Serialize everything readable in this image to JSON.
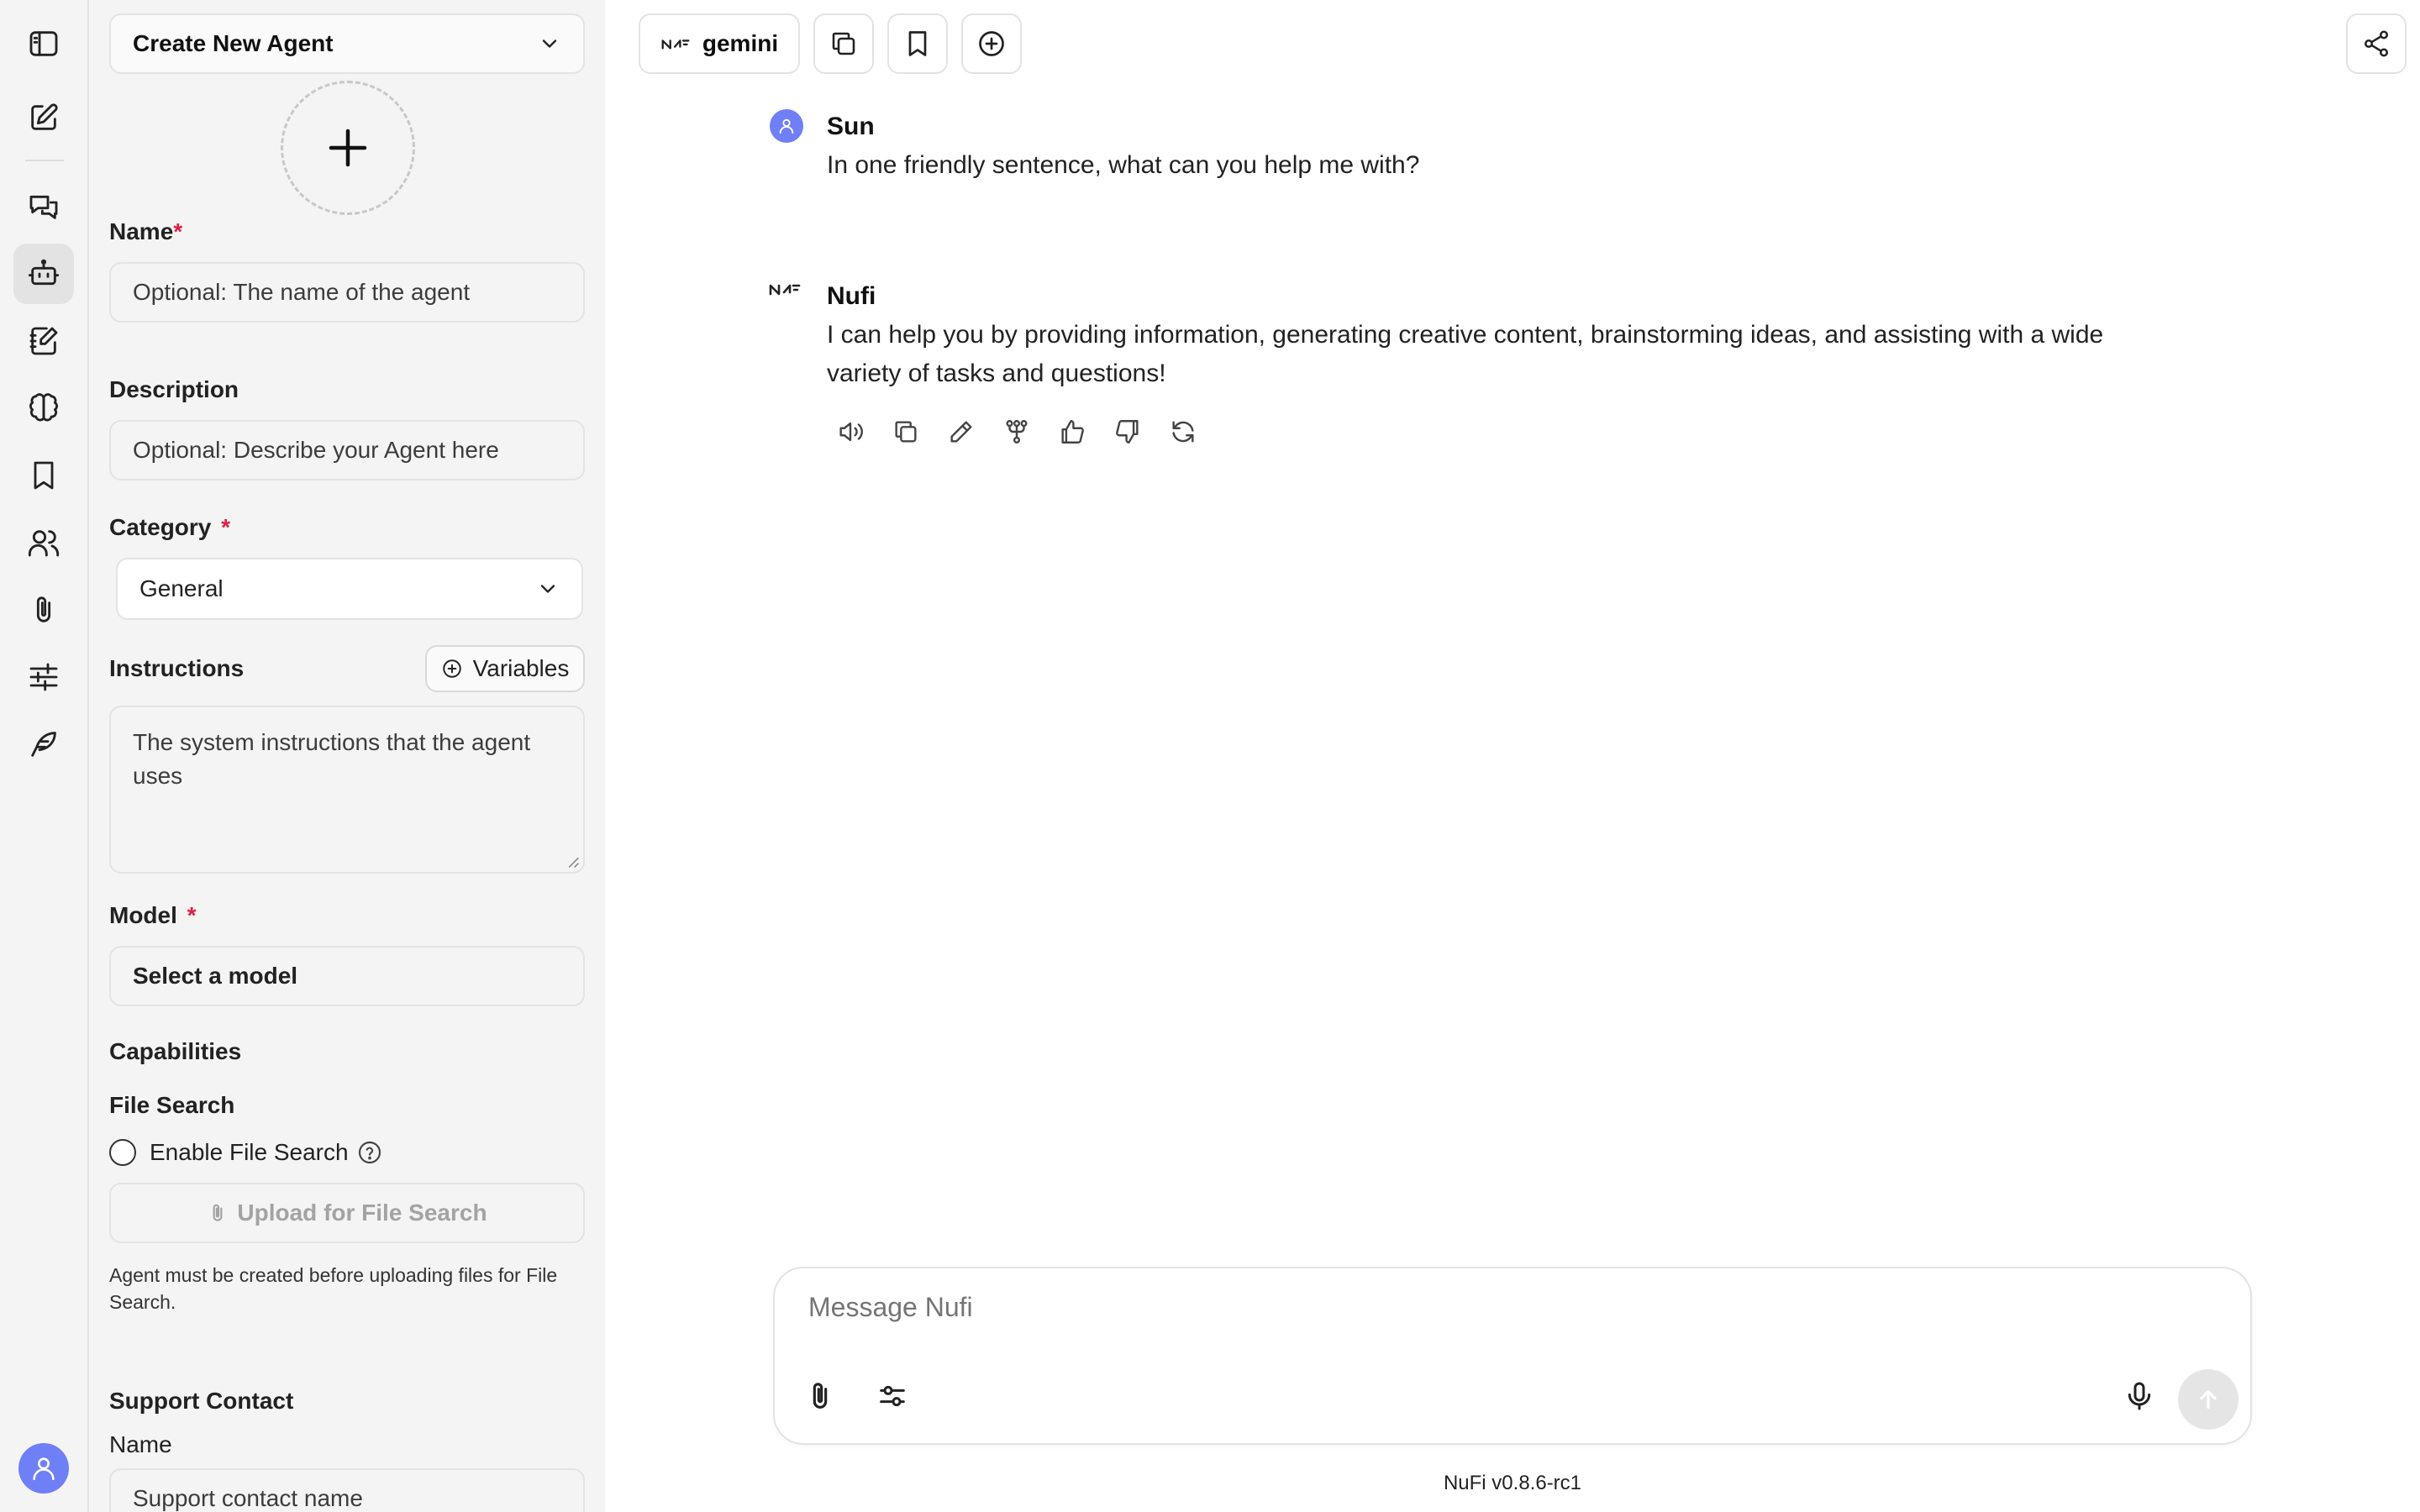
{
  "panel": {
    "agent_select": "Create New Agent",
    "name_label": "Name",
    "required_mark": "*",
    "name_placeholder": "Optional: The name of the agent",
    "description_label": "Description",
    "description_placeholder": "Optional: Describe your Agent here",
    "category_label": "Category",
    "category_value": "General",
    "instructions_label": "Instructions",
    "variables_button": "Variables",
    "instructions_placeholder": "The system instructions that the agent uses",
    "model_label": "Model",
    "model_select": "Select a model",
    "capabilities_label": "Capabilities",
    "file_search_label": "File Search",
    "enable_file_search": "Enable File Search",
    "upload_button": "Upload for File Search",
    "upload_help": "Agent must be created before uploading files for File Search.",
    "support_contact_label": "Support Contact",
    "support_name_label": "Name",
    "support_name_placeholder": "Support contact name"
  },
  "topbar": {
    "model_name": "gemini"
  },
  "messages": [
    {
      "sender": "Sun",
      "text": "In one friendly sentence, what can you help me with?"
    },
    {
      "sender": "Nufi",
      "text": "I can help you by providing information, generating creative content, brainstorming ideas, and assisting with a wide variety of tasks and questions!"
    }
  ],
  "composer": {
    "placeholder": "Message Nufi"
  },
  "footer": {
    "version": "NuFi v0.8.6-rc1"
  },
  "colors": {
    "accent": "#6f7ff5",
    "required": "#e11d48",
    "sidebar_bg": "#f4f4f4"
  }
}
